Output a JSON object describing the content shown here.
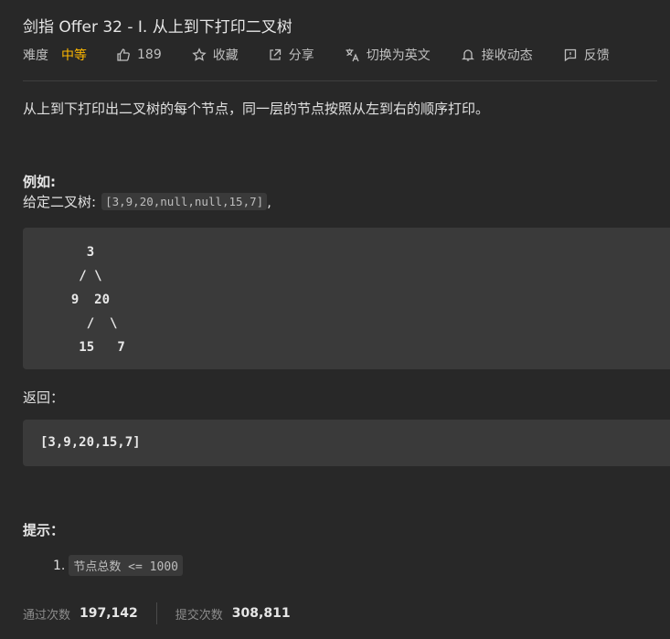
{
  "problem": {
    "title": "剑指 Offer 32 - I. 从上到下打印二叉树",
    "difficulty_label": "难度",
    "difficulty": "中等",
    "likes": "189",
    "favorite_label": "收藏",
    "share_label": "分享",
    "switch_lang_label": "切换为英文",
    "subscribe_label": "接收动态",
    "feedback_label": "反馈"
  },
  "content": {
    "description": "从上到下打印出二叉树的每个节点，同一层的节点按照从左到右的顺序打印。",
    "example_label": "例如:",
    "given_prefix": "给定二叉树:",
    "given_code": "[3,9,20,null,null,15,7]",
    "given_suffix": ",",
    "tree": "    3\n   / \\\n  9  20\n    /  \\\n   15   7",
    "return_label": "返回：",
    "result": "[3,9,20,15,7]",
    "hint_label": "提示：",
    "hints": [
      {
        "num": "1.",
        "code": "节点总数 <= 1000"
      }
    ]
  },
  "stats": {
    "accepted_label": "通过次数",
    "accepted": "197,142",
    "submissions_label": "提交次数",
    "submissions": "308,811"
  },
  "colors": {
    "background": "#282828",
    "difficulty_medium": "#ffb800",
    "code_background": "#3a3a3a"
  }
}
